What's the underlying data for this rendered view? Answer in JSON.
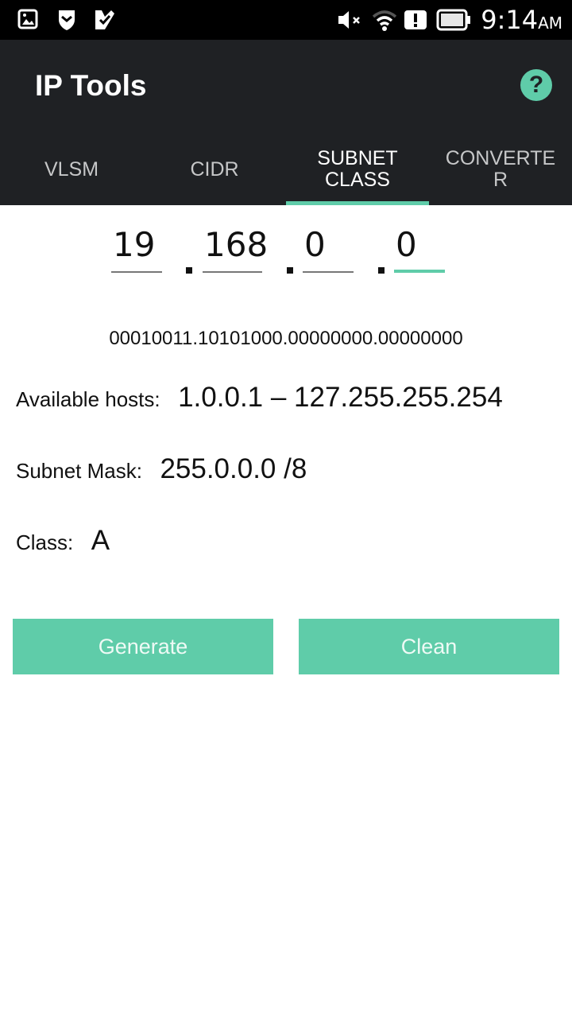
{
  "status_bar": {
    "left_icons": [
      "image-icon",
      "shield-icon",
      "check-icon"
    ],
    "right_icons": [
      "mute-icon",
      "wifi-icon",
      "alert-icon",
      "battery-icon"
    ],
    "time": "9:14",
    "ampm": "AM"
  },
  "app_bar": {
    "title": "IP Tools",
    "help_icon": "?"
  },
  "tabs": [
    {
      "label": "VLSM",
      "active": false
    },
    {
      "label": "CIDR",
      "active": false
    },
    {
      "label": "SUBNET\nCLASS",
      "active": true
    },
    {
      "label": "CONVERTE\nR",
      "active": false
    }
  ],
  "ip_input": {
    "octets": [
      "19",
      "168",
      "0",
      "0"
    ],
    "separator": "."
  },
  "binary": "00010011.10101000.00000000.00000000",
  "results": {
    "hosts_label": "Available hosts:",
    "hosts_value": "1.0.0.1 – 127.255.255.254",
    "mask_label": "Subnet Mask:",
    "mask_value": "255.0.0.0 /8",
    "class_label": "Class:",
    "class_value": "A"
  },
  "buttons": {
    "generate": "Generate",
    "clean": "Clean"
  },
  "colors": {
    "accent": "#5fcca9",
    "app_bar": "#1f2124"
  }
}
